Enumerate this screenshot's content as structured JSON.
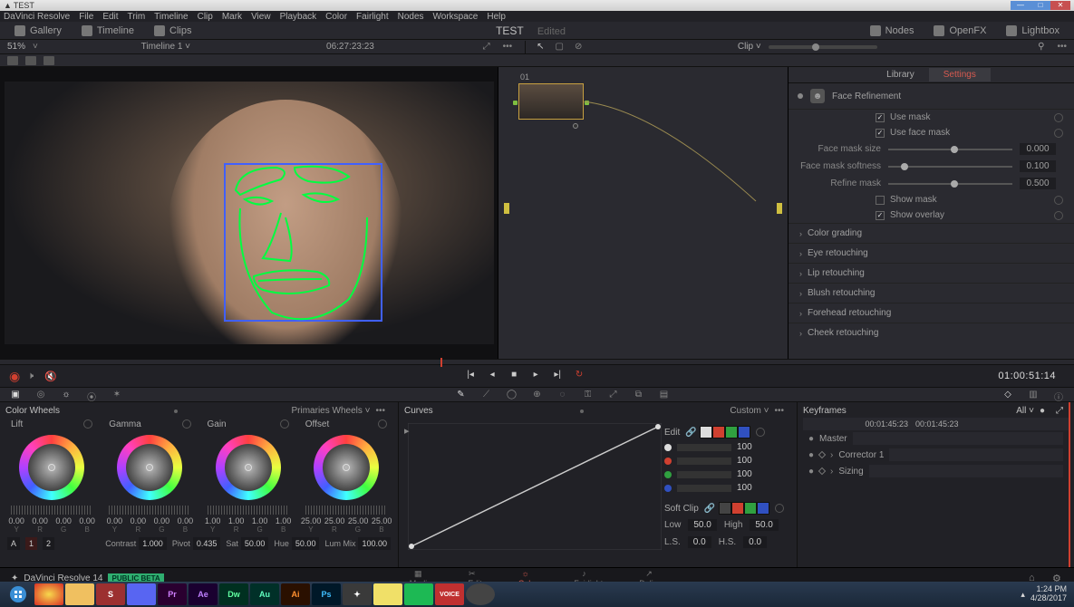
{
  "window": {
    "title": "TEST"
  },
  "menubar": [
    "DaVinci Resolve",
    "File",
    "Edit",
    "Trim",
    "Timeline",
    "Clip",
    "Mark",
    "View",
    "Playback",
    "Color",
    "Fairlight",
    "Nodes",
    "Workspace",
    "Help"
  ],
  "toolbar": {
    "gallery": "Gallery",
    "timeline": "Timeline",
    "clips": "Clips",
    "nodes": "Nodes",
    "openfx": "OpenFX",
    "lightbox": "Lightbox",
    "project": "TEST",
    "status": "Edited"
  },
  "timeline": {
    "zoom": "51%",
    "name": "Timeline 1",
    "source_tc": "06:27:23:23",
    "clip_label": "Clip",
    "viewer_tc": "01:00:51:14"
  },
  "nodes": {
    "label": "01"
  },
  "inspector": {
    "tabs": {
      "library": "Library",
      "settings": "Settings"
    },
    "heading": "Face Refinement",
    "use_mask": "Use mask",
    "use_face_mask": "Use face mask",
    "face_mask_size": {
      "label": "Face mask size",
      "value": "0.000",
      "knob": 50
    },
    "face_mask_softness": {
      "label": "Face mask softness",
      "value": "0.100",
      "knob": 10
    },
    "refine_mask": {
      "label": "Refine mask",
      "value": "0.500",
      "knob": 50
    },
    "show_mask": "Show mask",
    "show_overlay": "Show overlay",
    "sections": [
      "Color grading",
      "Eye retouching",
      "Lip retouching",
      "Blush retouching",
      "Forehead retouching",
      "Cheek retouching"
    ]
  },
  "wheels": {
    "title": "Color Wheels",
    "mode": "Primaries Wheels",
    "cols": [
      {
        "name": "Lift",
        "vals": [
          "0.00",
          "0.00",
          "0.00",
          "0.00"
        ]
      },
      {
        "name": "Gamma",
        "vals": [
          "0.00",
          "0.00",
          "0.00",
          "0.00"
        ]
      },
      {
        "name": "Gain",
        "vals": [
          "1.00",
          "1.00",
          "1.00",
          "1.00"
        ]
      },
      {
        "name": "Offset",
        "vals": [
          "25.00",
          "25.00",
          "25.00",
          "25.00"
        ]
      }
    ],
    "yrgb": [
      "Y",
      "R",
      "G",
      "B"
    ],
    "ab": {
      "a": "A",
      "one": "1",
      "two": "2"
    },
    "bottom": {
      "contrast_l": "Contrast",
      "contrast_v": "1.000",
      "pivot_l": "Pivot",
      "pivot_v": "0.435",
      "sat_l": "Sat",
      "sat_v": "50.00",
      "hue_l": "Hue",
      "hue_v": "50.00",
      "lummix_l": "Lum Mix",
      "lummix_v": "100.00"
    }
  },
  "curves": {
    "title": "Curves",
    "mode": "Custom",
    "edit": "Edit",
    "channels": [
      {
        "color": "#dddddd",
        "val": "100"
      },
      {
        "color": "#d04030",
        "val": "100"
      },
      {
        "color": "#30a040",
        "val": "100"
      },
      {
        "color": "#3050c0",
        "val": "100"
      }
    ],
    "softclip": "Soft Clip",
    "low_l": "Low",
    "low_v": "50.0",
    "high_l": "High",
    "high_v": "50.0",
    "ls_l": "L.S.",
    "ls_v": "0.0",
    "hs_l": "H.S.",
    "hs_v": "0.0"
  },
  "keyframes": {
    "title": "Keyframes",
    "all": "All",
    "tc_left": "00:01:45:23",
    "tc_right": "00:01:45:23",
    "items": [
      "Master",
      "Corrector 1",
      "Sizing"
    ]
  },
  "pages": [
    "Media",
    "Edit",
    "Color",
    "Fairlight",
    "Deliver"
  ],
  "brand": {
    "name": "DaVinci Resolve 14",
    "badge": "PUBLIC BETA"
  },
  "taskbar": {
    "time": "1:24 PM",
    "date": "4/28/2017"
  }
}
